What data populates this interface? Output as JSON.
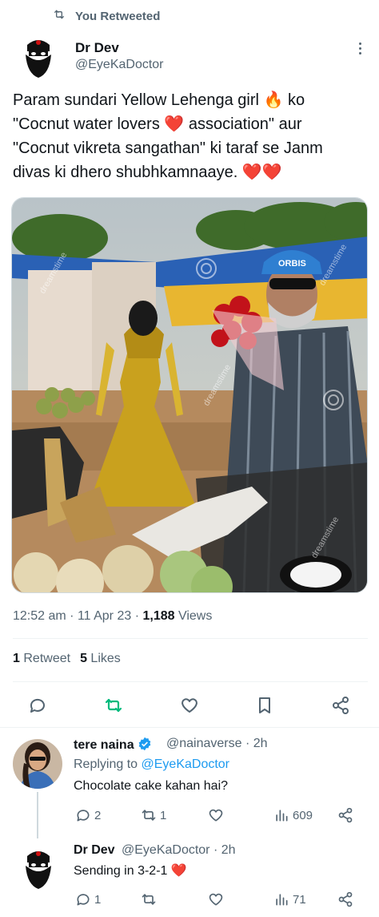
{
  "retweet_banner": {
    "label": "You Retweeted"
  },
  "tweet": {
    "author_name": "Dr Dev",
    "author_handle": "@EyeKaDoctor",
    "text_lines": [
      "Param sundari Yellow Lehenga girl 🔥 ko",
      "\"Cocnut water lovers ❤️ association\" aur",
      "\"Cocnut vikreta sangathan\" ki taraf se Janm",
      "divas ki dhero shubhkamnaaye. ❤️❤️"
    ],
    "media": {
      "cap_text": "ORBIS",
      "watermark": "dreamstime"
    },
    "time": "12:52 am",
    "date": "11 Apr 23",
    "views_count": "1,188",
    "views_label": "Views",
    "retweets_count": "1",
    "retweets_label": "Retweet",
    "likes_count": "5",
    "likes_label": "Likes"
  },
  "replies": [
    {
      "name": "tere naina",
      "handle_time": "@nainaverse · 2h",
      "replying_prefix": "Replying to",
      "replying_handle": "@EyeKaDoctor",
      "text": "Chocolate cake kahan hai?",
      "reply_count": "2",
      "retweet_count": "1",
      "views_count": "609"
    },
    {
      "name": "Dr Dev",
      "handle_time": "@EyeKaDoctor · 2h",
      "text": "Sending in 3-2-1 ❤️",
      "reply_count": "1",
      "views_count": "71"
    }
  ],
  "colors": {
    "accent": "#1d9bf0",
    "retweet_green": "#00ba7c",
    "muted": "#536471",
    "heart_red": "#e0245e"
  }
}
